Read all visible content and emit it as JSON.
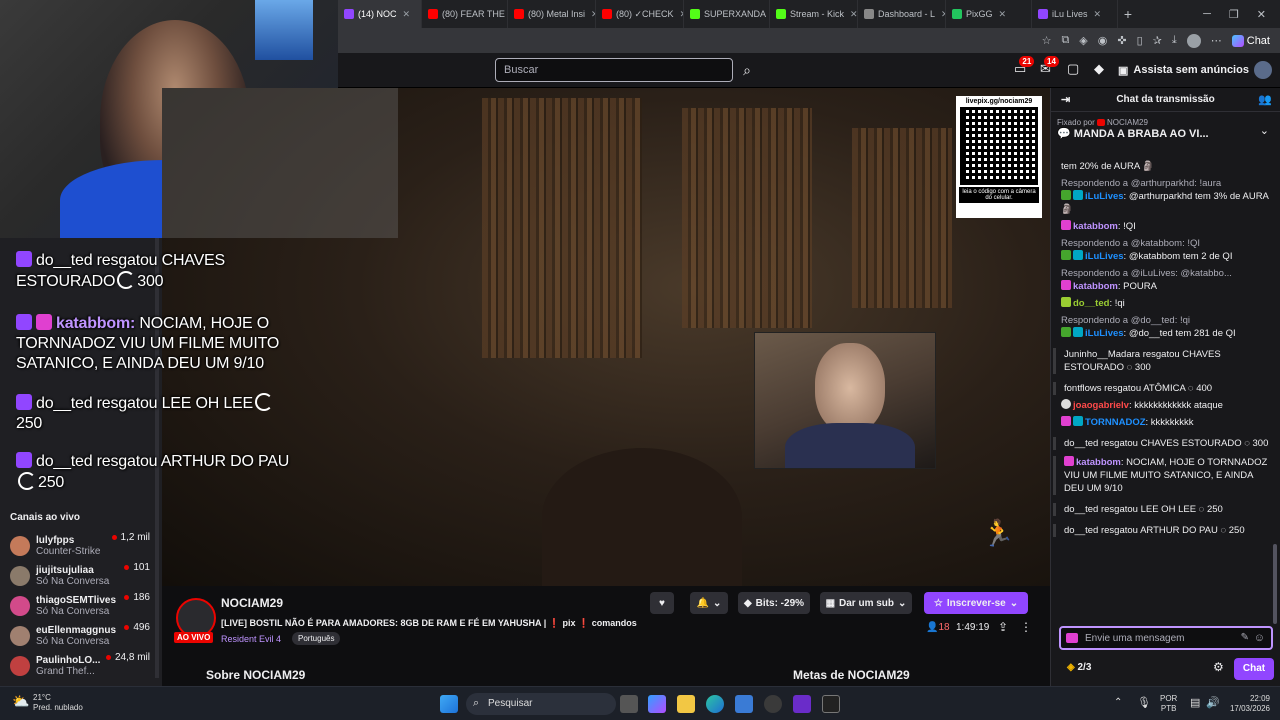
{
  "tabs": [
    {
      "label": "(14) NOC",
      "active": true,
      "color": "#9146ff"
    },
    {
      "label": "(80) FEAR THE",
      "active": false,
      "color": "#ff0000"
    },
    {
      "label": "(80) Metal Insi",
      "active": false,
      "color": "#ff0000"
    },
    {
      "label": "(80) ✓CHECK",
      "active": false,
      "color": "#ff0000"
    },
    {
      "label": "SUPERXANDA",
      "active": false,
      "color": "#53fc18"
    },
    {
      "label": "Stream - Kick",
      "active": false,
      "color": "#53fc18"
    },
    {
      "label": "Dashboard - L",
      "active": false,
      "color": "#888888"
    },
    {
      "label": "PixGG",
      "active": false,
      "color": "#22c55e"
    },
    {
      "label": "iLu Lives",
      "active": false,
      "color": "#9146ff"
    }
  ],
  "toolbar": {
    "chat_label": "Chat"
  },
  "topnav": {
    "search_placeholder": "Buscar",
    "notif_count_1": "21",
    "notif_count_2": "14",
    "turbo_label": "Assista sem anúncios"
  },
  "sidebar": {
    "live_channels_title": "Canais ao vivo",
    "channels": [
      {
        "name": "lulyfpps",
        "game": "Counter-Strike",
        "viewers": "1,2 mil",
        "color": "#c47a5a"
      },
      {
        "name": "jiujitsujuliaa",
        "game": "Só Na Conversa",
        "viewers": "101",
        "color": "#8a7a6a"
      },
      {
        "name": "thiagoSEMTlives",
        "game": "Só Na Conversa",
        "viewers": "186",
        "color": "#d24a8a"
      },
      {
        "name": "euEllenmaggnus",
        "game": "Só Na Conversa",
        "viewers": "496",
        "color": "#a08070"
      },
      {
        "name": "PaulinhoLO...",
        "game": "Grand Thef...",
        "viewers": "24,8 mil",
        "color": "#c04040"
      }
    ]
  },
  "overlay": {
    "line1": "do__ted resgatou CHAVES",
    "line1b": "ESTOURADO",
    "line1_cost": "300",
    "line2_user": "katabbom:",
    "line2": "NOCIAM, HOJE O",
    "line2b": "TORNNADOZ VIU UM FILME MUITO",
    "line2c": "SATANICO, E AINDA DEU UM 9/10",
    "line3": "do__ted resgatou LEE OH LEE",
    "line3_cost": "250",
    "line4": "do__ted resgatou ARTHUR DO PAU",
    "line4_cost": "250"
  },
  "qr": {
    "url": "livepix.gg/nociam29",
    "caption": "leia o código com a câmera do celular."
  },
  "stream": {
    "channel": "NOCIAM29",
    "title": "[LIVE] BOSTIL NÃO É PARA AMADORES: 8GB DE RAM E FÉ EM YAHUSHA |",
    "title_tag1": "pix",
    "title_tag2": "comandos",
    "game": "Resident Evil 4",
    "language": "Português",
    "live_label": "AO VIVO",
    "viewers": "18",
    "uptime": "1:49:19",
    "bits_label": "Bits: -29%",
    "gift_label": "Dar um sub",
    "subscribe_label": "Inscrever-se",
    "about_label": "Sobre NOCIAM29",
    "goals_label": "Metas de NOCIAM29"
  },
  "chat": {
    "header": "Chat da transmissão",
    "pinned_by": "Fixado por",
    "pinned_user": "NOCIAM29",
    "pinned_text": "MANDA A BRABA AO VI...",
    "input_placeholder": "Envie uma mensagem",
    "points": "2/3",
    "send_label": "Chat",
    "messages": [
      {
        "kind": "text",
        "text": "tem 20% de AURA 🗿"
      },
      {
        "kind": "reply",
        "reply": "Respondendo a @arthurparkhd: !aura",
        "user": "iLuLives",
        "ucls": "u-cyan",
        "text": ": @arthurparkhd tem 3% de AURA 🗿"
      },
      {
        "kind": "plain",
        "user": "katabbom",
        "ucls": "u-purple",
        "text": ": !QI"
      },
      {
        "kind": "reply",
        "reply": "Respondendo a @katabbom: !QI",
        "user": "iLuLives",
        "ucls": "u-cyan",
        "text": ": @katabbom tem 2 de QI"
      },
      {
        "kind": "reply",
        "reply": "Respondendo a @iLuLives: @katabbo...",
        "user": "katabbom",
        "ucls": "u-purple",
        "text": ": POURA"
      },
      {
        "kind": "plain",
        "user": "do__ted",
        "ucls": "u-green",
        "text": ": !qi"
      },
      {
        "kind": "reply",
        "reply": "Respondendo a @do__ted: !qi",
        "user": "iLuLives",
        "ucls": "u-cyan",
        "text": ": @do__ted tem 281 de QI"
      },
      {
        "kind": "sys",
        "text": "Juninho__Madara resgatou CHAVES ESTOURADO ◌ 300"
      },
      {
        "kind": "sys",
        "text": "fontflows resgatou ATÔMICA ◌ 400"
      },
      {
        "kind": "plain",
        "user": "joaogabrielv",
        "ucls": "u-red",
        "text": ": kkkkkkkkkkkk ataque"
      },
      {
        "kind": "plain",
        "user": "TORNNADOZ",
        "ucls": "u-cyan",
        "text": ": kkkkkkkkk"
      },
      {
        "kind": "sys",
        "text": "do__ted resgatou CHAVES ESTOURADO ◌ 300"
      },
      {
        "kind": "plain",
        "user": "katabbom",
        "ucls": "u-purple",
        "text": ": NOCIAM, HOJE O TORNNADOZ VIU UM FILME MUITO SATANICO, E AINDA DEU UM 9/10"
      },
      {
        "kind": "sys",
        "text": "do__ted resgatou LEE OH LEE ◌ 250"
      },
      {
        "kind": "sys",
        "text": "do__ted resgatou ARTHUR DO PAU ◌ 250"
      }
    ]
  },
  "taskbar": {
    "temp": "21°C",
    "weather": "Pred. nublado",
    "search": "Pesquisar",
    "lang": "POR",
    "kb": "PTB",
    "time": "22:09",
    "date": "17/03/2026"
  }
}
